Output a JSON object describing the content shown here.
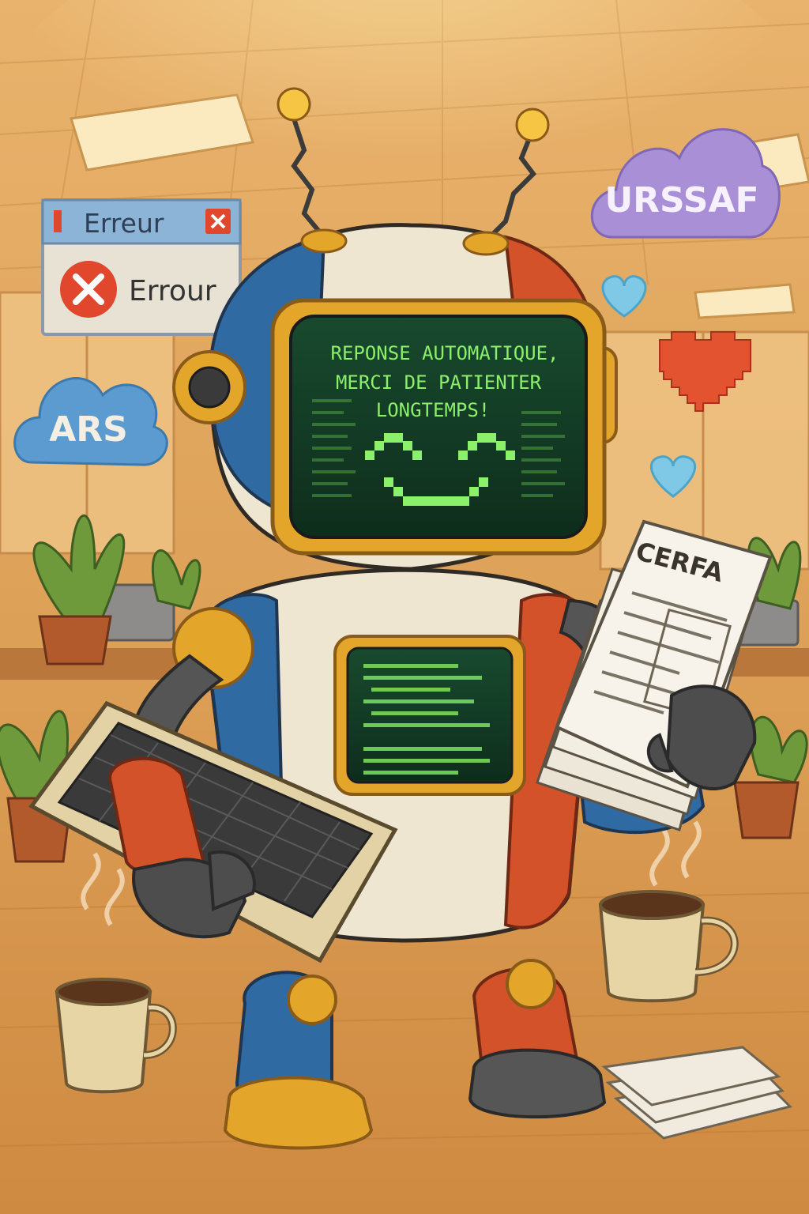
{
  "error_dialog": {
    "title": "Erreur",
    "message": "Errour"
  },
  "clouds": {
    "left": "ARS",
    "right": "URSSAF"
  },
  "robot_screen": {
    "line1": "REPONSE AUTOMATIQUE,",
    "line2": "MERCI DE PATIENTER",
    "line3": "LONGTEMPS!"
  },
  "document": {
    "title": "CERFA"
  },
  "colors": {
    "robot_blue": "#2f6aa3",
    "robot_red": "#d4522a",
    "robot_white": "#efe6d2",
    "robot_gold": "#e3a62a",
    "screen_green": "#8bf06a",
    "screen_bg": "#123a24",
    "urssaf_cloud": "#a98fd6",
    "ars_cloud": "#5b9bd0",
    "heart_red": "#e4532f",
    "heart_blue": "#7fc9e6",
    "error_red": "#e0472d"
  },
  "icons": [
    "close-icon",
    "error-icon",
    "heart-icon",
    "coffee-mug-icon",
    "keyboard-icon",
    "document-icon"
  ]
}
